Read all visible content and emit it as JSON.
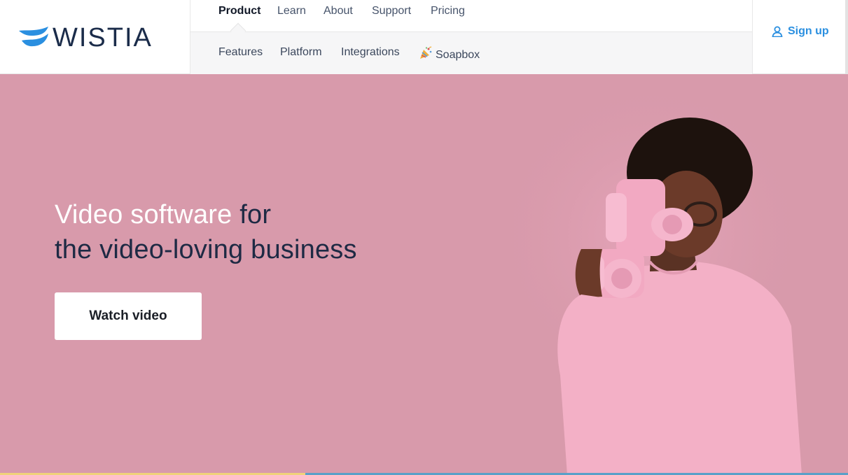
{
  "brand": {
    "name": "WISTIA",
    "colors": {
      "logo_blue": "#2a8fe0",
      "logo_navy": "#1b2c4a"
    }
  },
  "nav": {
    "primary": [
      {
        "label": "Product",
        "active": true
      },
      {
        "label": "Learn"
      },
      {
        "label": "About"
      },
      {
        "label": "Support"
      },
      {
        "label": "Pricing"
      }
    ],
    "secondary": [
      {
        "label": "Features"
      },
      {
        "label": "Platform"
      },
      {
        "label": "Integrations"
      },
      {
        "label": "Soapbox",
        "icon": "party-popper-icon"
      }
    ]
  },
  "account": {
    "signup_label": "Sign up",
    "icon": "user-icon",
    "color": "#2a8fe0"
  },
  "hero": {
    "headline_highlight": "Video software",
    "headline_rest": " for",
    "headline_line2": "the video-loving business",
    "cta_label": "Watch video",
    "background": "#d89aab",
    "image": "person-with-pink-camera-illustration"
  },
  "video_progress": 0.36
}
